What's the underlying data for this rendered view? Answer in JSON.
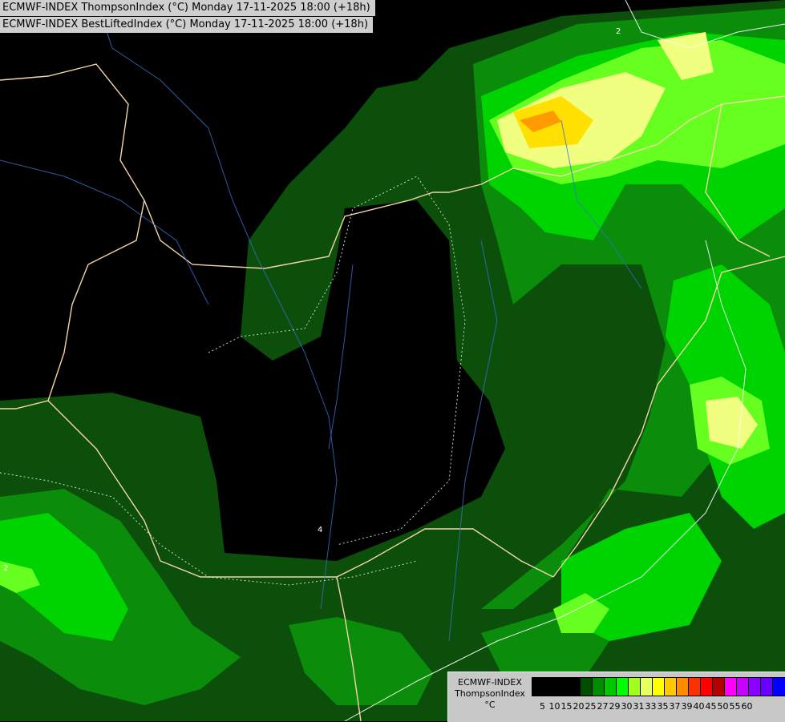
{
  "map": {
    "title_line_1": "ECMWF-INDEX ThompsonIndex (°C) Monday 17-11-2025 18:00 (+18h)",
    "title_line_2": "ECMWF-INDEX BestLiftedIndex (°C) Monday 17-11-2025 18:00 (+18h)",
    "contour_labels": [
      "2",
      "4",
      "2",
      "2"
    ]
  },
  "legend": {
    "title_lines": [
      "ECMWF-INDEX",
      "ThompsonIndex",
      "°C"
    ],
    "colors": [
      "#000000",
      "#000000",
      "#000000",
      "#000000",
      "#004d00",
      "#008c00",
      "#00c800",
      "#00ff00",
      "#a0ff20",
      "#e8ff60",
      "#ffff00",
      "#ffc800",
      "#ff8c00",
      "#ff3000",
      "#ff0000",
      "#b40000",
      "#ff00ff",
      "#c800ff",
      "#8c00ff",
      "#6a00ff",
      "#0000ff"
    ],
    "ticks": [
      "5",
      "10",
      "15",
      "20",
      "25",
      "27",
      "29",
      "30",
      "31",
      "33",
      "35",
      "37",
      "39",
      "40",
      "45",
      "50",
      "55",
      "60"
    ]
  }
}
